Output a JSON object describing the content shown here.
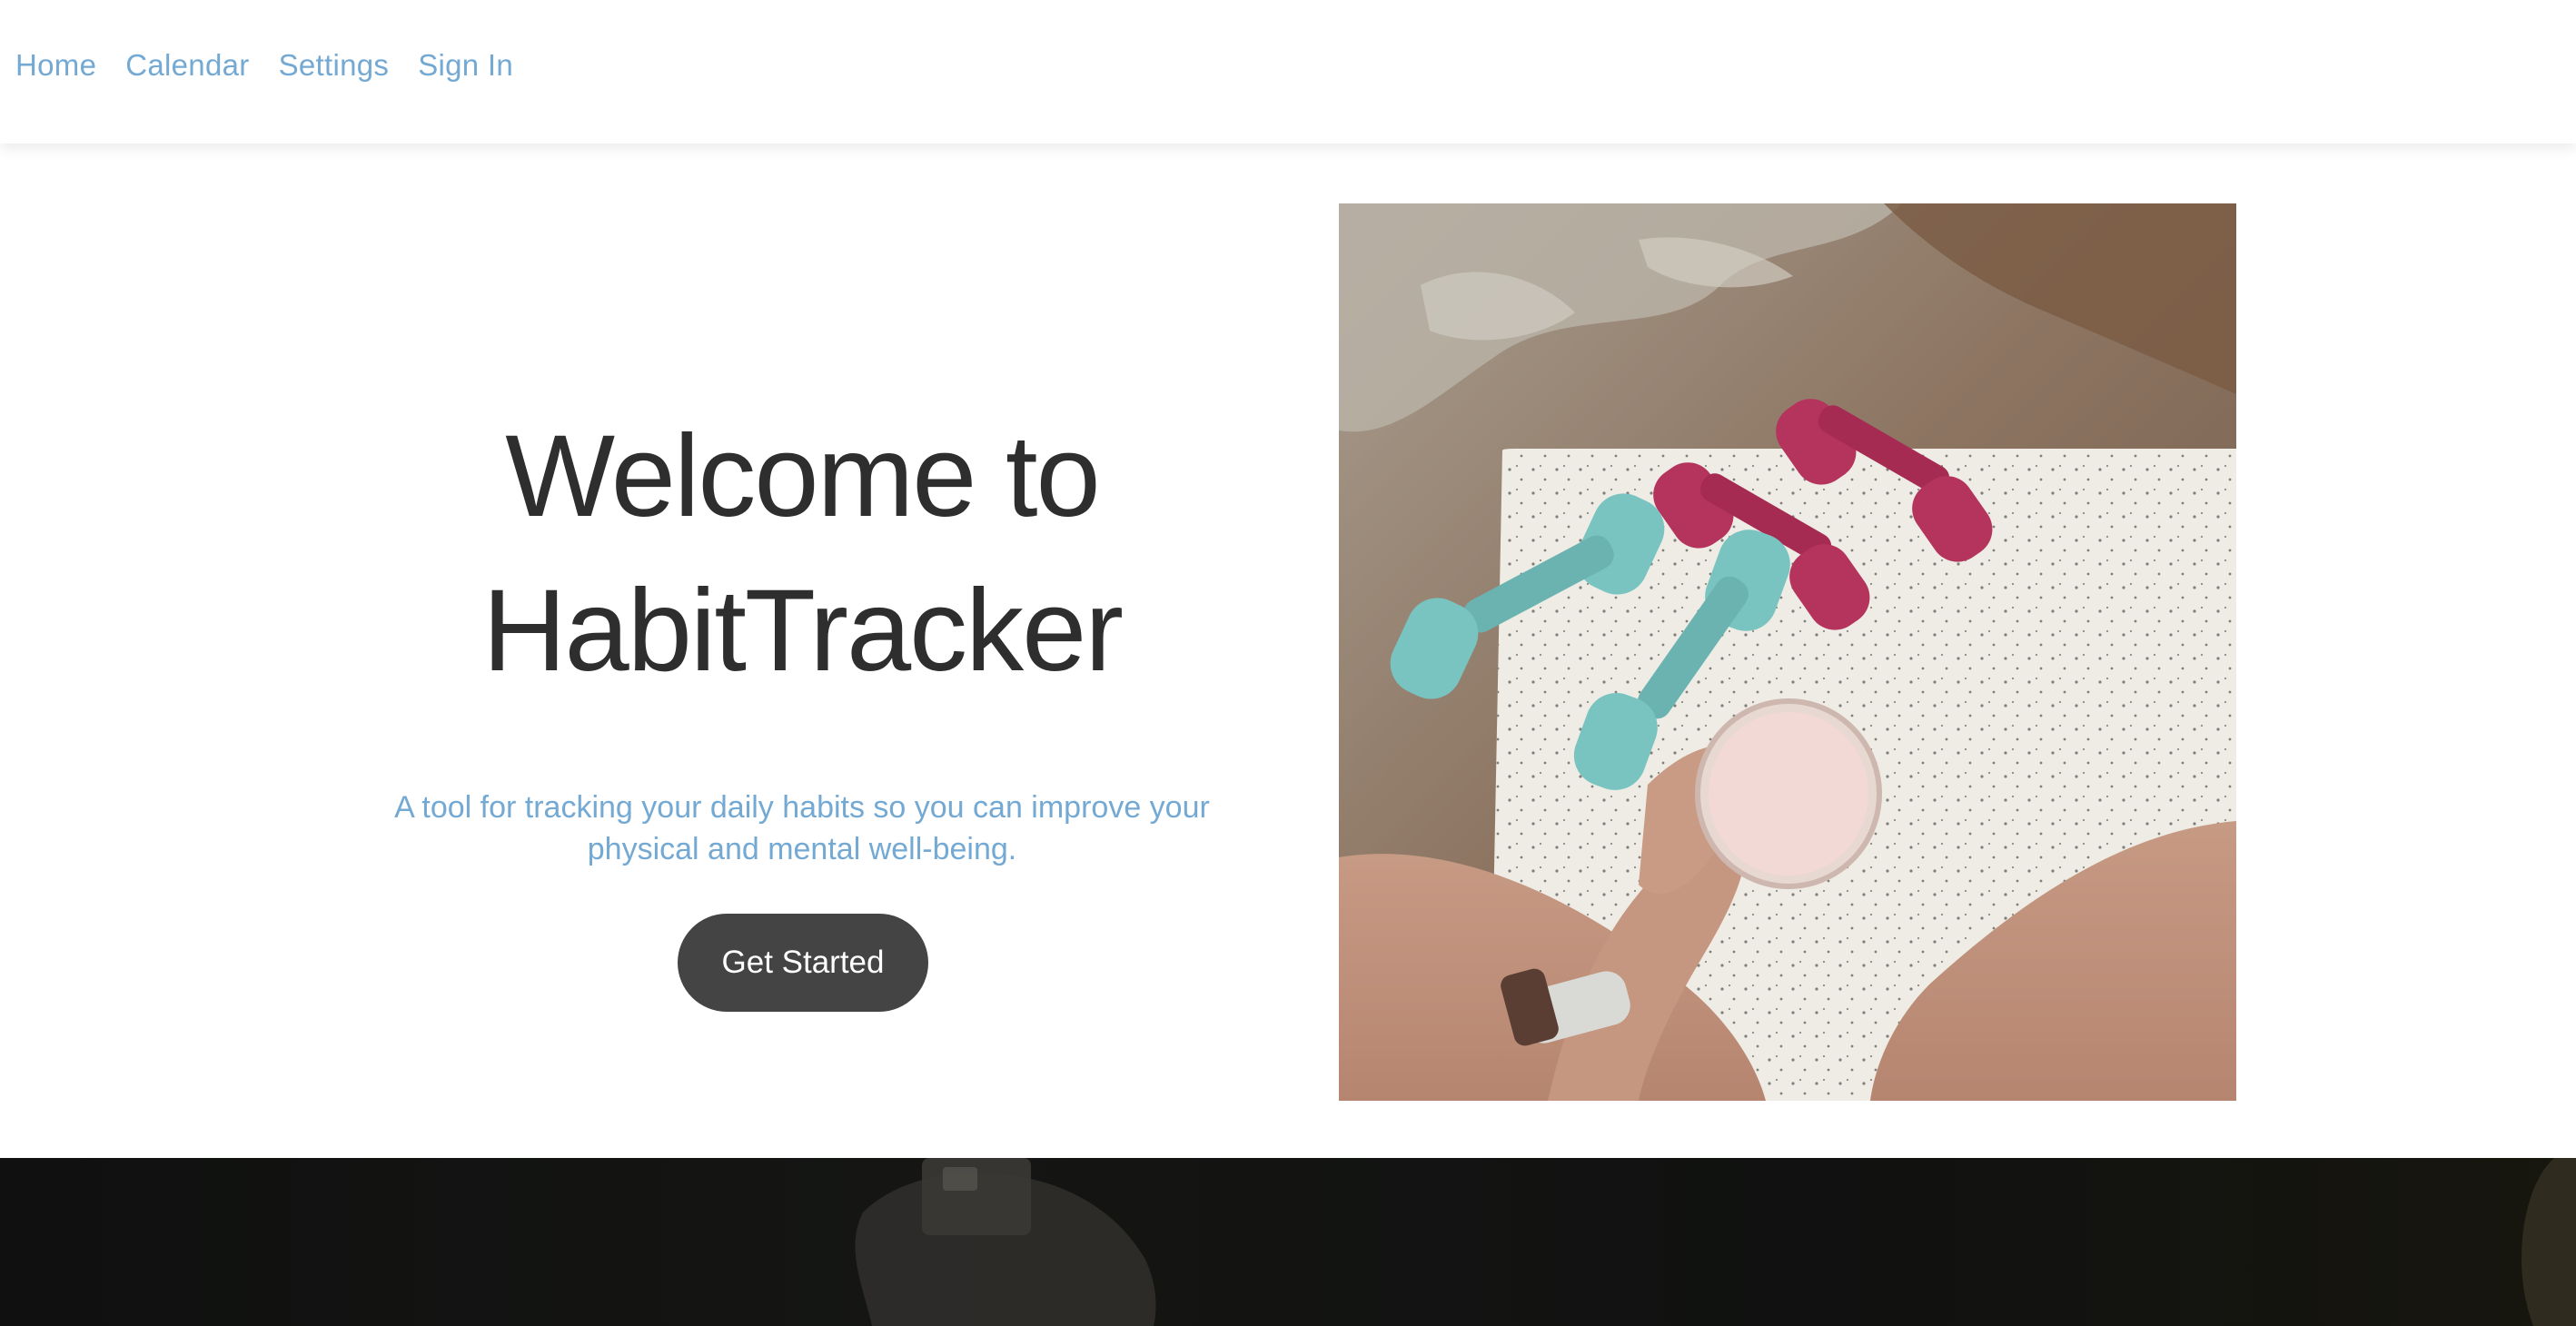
{
  "nav": {
    "items": [
      {
        "label": "Home"
      },
      {
        "label": "Calendar"
      },
      {
        "label": "Settings"
      },
      {
        "label": "Sign In"
      }
    ]
  },
  "hero": {
    "title_line1": "Welcome to",
    "title_line2": "HabitTracker",
    "subtitle": "A tool for tracking your daily habits so you can improve your physical and mental well-being.",
    "cta_label": "Get Started",
    "image_icon": "fitness-photo"
  },
  "colors": {
    "nav_link": "#73a9d3",
    "title": "#2e2e2e",
    "subtitle": "#73a9d3",
    "button_bg": "#444444",
    "button_text": "#ffffff",
    "footer_band": "#111211"
  }
}
